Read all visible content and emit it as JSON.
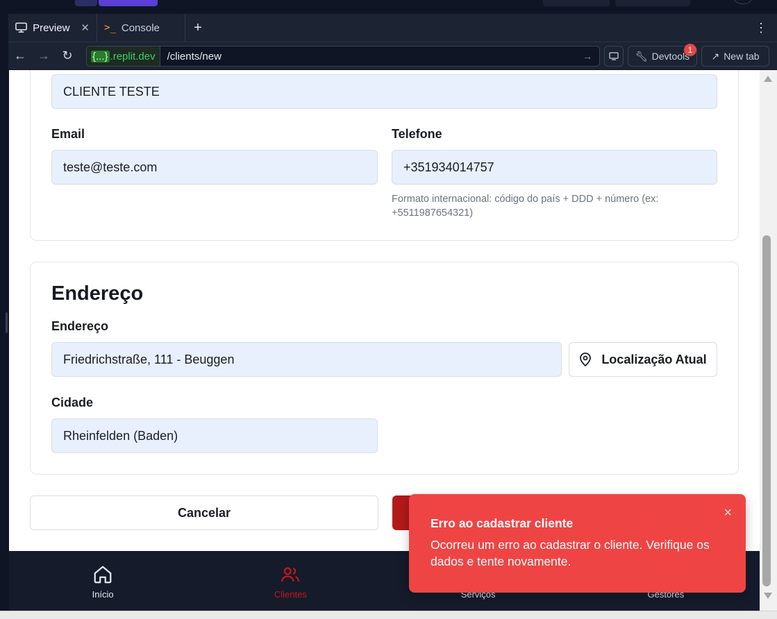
{
  "browser": {
    "tabs": [
      {
        "label": "Preview",
        "icon": "monitor-icon",
        "active": true
      },
      {
        "label": "Console",
        "icon": "terminal-icon",
        "active": false
      }
    ],
    "add_tab": "+",
    "menu": "⋮",
    "url_domain_prefix": "{...}",
    "url_domain": ".replit.dev",
    "url_path": "/clients/new",
    "devtools_label": "Devtools",
    "devtools_badge": "1",
    "new_tab_label": "New tab"
  },
  "form": {
    "name_value": "CLIENTE TESTE",
    "email_label": "Email",
    "email_value": "teste@teste.com",
    "phone_label": "Telefone",
    "phone_value": "+351934014757",
    "phone_hint": "Formato internacional: código do país + DDD + número (ex: +5511987654321)",
    "address_section_title": "Endereço",
    "address_label": "Endereço",
    "address_value": "Friedrichstraße, 111 - Beuggen",
    "location_button": "Localização Atual",
    "city_label": "Cidade",
    "city_value": "Rheinfelden (Baden)",
    "cancel_button": "Cancelar"
  },
  "bottom_nav": {
    "items": [
      {
        "label": "Início",
        "icon": "home-icon",
        "active": false
      },
      {
        "label": "Clientes",
        "icon": "users-icon",
        "active": true
      },
      {
        "label": "Serviços",
        "icon": "wrench-icon",
        "active": false
      },
      {
        "label": "Gestores",
        "icon": "user-gear-icon",
        "active": false
      }
    ]
  },
  "toast": {
    "title": "Erro ao cadastrar cliente",
    "message": "Ocorreu um erro ao cadastrar o cliente. Verifique os dados e tente novamente.",
    "close": "×"
  },
  "colors": {
    "accent_red": "#b21a1a",
    "toast_bg": "#ef4444",
    "input_bg": "#e8f0fe"
  }
}
